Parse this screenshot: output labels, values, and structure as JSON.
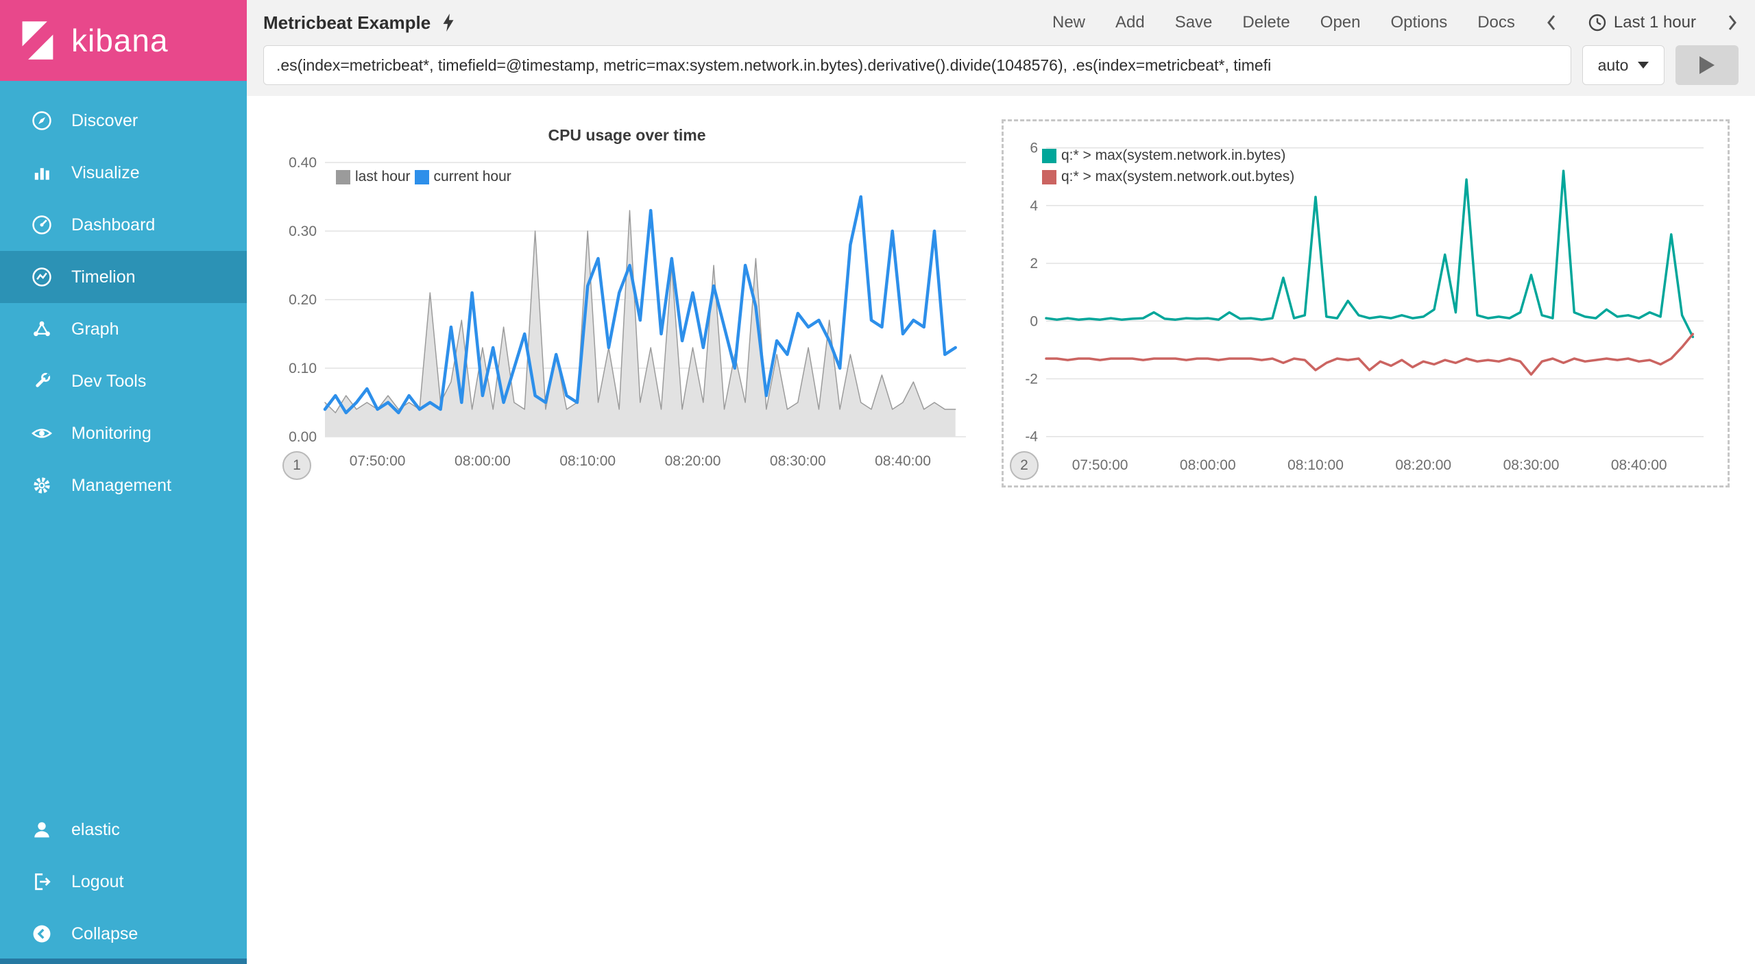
{
  "colors": {
    "brand_pink": "#e8488b",
    "sidebar_teal": "#3caed2",
    "sidebar_selected": "#2c92b5",
    "cpu_last_hour": "#9b9b9b",
    "cpu_current_hour": "#2d8fea",
    "network_in": "#00a69a",
    "network_out": "#cb6461"
  },
  "sidebar": {
    "logo_text": "kibana",
    "items": [
      {
        "label": "Discover",
        "icon": "discover-icon",
        "selected": false
      },
      {
        "label": "Visualize",
        "icon": "visualize-icon",
        "selected": false
      },
      {
        "label": "Dashboard",
        "icon": "dashboard-icon",
        "selected": false
      },
      {
        "label": "Timelion",
        "icon": "timelion-icon",
        "selected": true
      },
      {
        "label": "Graph",
        "icon": "graph-icon",
        "selected": false
      },
      {
        "label": "Dev Tools",
        "icon": "devtools-icon",
        "selected": false
      },
      {
        "label": "Monitoring",
        "icon": "monitoring-icon",
        "selected": false
      },
      {
        "label": "Management",
        "icon": "management-icon",
        "selected": false
      }
    ],
    "bottom_items": [
      {
        "label": "elastic",
        "icon": "user-icon"
      },
      {
        "label": "Logout",
        "icon": "logout-icon"
      },
      {
        "label": "Collapse",
        "icon": "collapse-icon"
      }
    ]
  },
  "topbar": {
    "title": "Metricbeat Example",
    "menu": [
      "New",
      "Add",
      "Save",
      "Delete",
      "Open",
      "Options",
      "Docs"
    ],
    "time_picker": "Last 1 hour"
  },
  "querybar": {
    "value": ".es(index=metricbeat*, timefield=@timestamp, metric=max:system.network.in.bytes).derivative().divide(1048576), .es(index=metricbeat*, timefi",
    "interval": "auto"
  },
  "chart_data": [
    {
      "type": "line",
      "title": "CPU usage over time",
      "panel_number": "1",
      "x_ticks": [
        "07:50:00",
        "08:00:00",
        "08:10:00",
        "08:20:00",
        "08:30:00",
        "08:40:00"
      ],
      "x_tick_pos": [
        5,
        15,
        25,
        35,
        45,
        55
      ],
      "x_range": [
        0,
        61
      ],
      "y_ticks": [
        0,
        0.1,
        0.2,
        0.3,
        0.4
      ],
      "y_tick_labels": [
        "0.00",
        "0.10",
        "0.20",
        "0.30",
        "0.40"
      ],
      "ylim": [
        0,
        0.405
      ],
      "legend_position": "top-left",
      "grid": true,
      "series": [
        {
          "name": "last hour",
          "color": "#9b9b9b",
          "fill": "#e2e2e2",
          "area": true,
          "stroke_width": 1.5,
          "values": [
            0.05,
            0.035,
            0.06,
            0.04,
            0.05,
            0.04,
            0.06,
            0.04,
            0.05,
            0.04,
            0.21,
            0.05,
            0.08,
            0.17,
            0.04,
            0.13,
            0.04,
            0.16,
            0.05,
            0.04,
            0.3,
            0.04,
            0.12,
            0.04,
            0.05,
            0.3,
            0.05,
            0.13,
            0.04,
            0.33,
            0.05,
            0.13,
            0.04,
            0.25,
            0.04,
            0.13,
            0.05,
            0.25,
            0.04,
            0.12,
            0.05,
            0.26,
            0.04,
            0.12,
            0.04,
            0.05,
            0.13,
            0.04,
            0.17,
            0.04,
            0.12,
            0.05,
            0.04,
            0.09,
            0.04,
            0.05,
            0.08,
            0.04,
            0.05,
            0.04,
            0.04
          ]
        },
        {
          "name": "current hour",
          "color": "#2d8fea",
          "area": false,
          "stroke_width": 4.5,
          "values": [
            0.04,
            0.06,
            0.035,
            0.05,
            0.07,
            0.04,
            0.05,
            0.035,
            0.06,
            0.04,
            0.05,
            0.04,
            0.16,
            0.05,
            0.21,
            0.06,
            0.13,
            0.05,
            0.1,
            0.15,
            0.06,
            0.05,
            0.12,
            0.06,
            0.05,
            0.22,
            0.26,
            0.13,
            0.21,
            0.25,
            0.17,
            0.33,
            0.15,
            0.26,
            0.14,
            0.21,
            0.13,
            0.22,
            0.16,
            0.1,
            0.25,
            0.19,
            0.06,
            0.14,
            0.12,
            0.18,
            0.16,
            0.17,
            0.14,
            0.1,
            0.28,
            0.35,
            0.17,
            0.16,
            0.3,
            0.15,
            0.17,
            0.16,
            0.3,
            0.12,
            0.13
          ]
        }
      ]
    },
    {
      "type": "line",
      "title": "",
      "panel_number": "2",
      "selected": true,
      "x_ticks": [
        "07:50:00",
        "08:00:00",
        "08:10:00",
        "08:20:00",
        "08:30:00",
        "08:40:00"
      ],
      "x_tick_pos": [
        5,
        15,
        25,
        35,
        45,
        55
      ],
      "x_range": [
        0,
        61
      ],
      "y_ticks": [
        6,
        4,
        2,
        0,
        -2,
        -4
      ],
      "y_tick_labels": [
        "6",
        "4",
        "2",
        "0",
        "-2",
        "-4"
      ],
      "ylim": [
        -4.15,
        6.3
      ],
      "legend_position": "top-left",
      "grid": true,
      "series": [
        {
          "name": "q:* > max(system.network.in.bytes)",
          "color": "#00a69a",
          "area": false,
          "stroke_width": 3.5,
          "values": [
            0.1,
            0.05,
            0.1,
            0.05,
            0.08,
            0.05,
            0.1,
            0.05,
            0.08,
            0.1,
            0.3,
            0.08,
            0.05,
            0.1,
            0.08,
            0.1,
            0.05,
            0.3,
            0.08,
            0.1,
            0.05,
            0.1,
            1.5,
            0.1,
            0.2,
            4.3,
            0.15,
            0.1,
            0.7,
            0.2,
            0.1,
            0.15,
            0.1,
            0.2,
            0.1,
            0.15,
            0.4,
            2.3,
            0.3,
            4.9,
            0.2,
            0.1,
            0.15,
            0.1,
            0.3,
            1.6,
            0.2,
            0.1,
            5.2,
            0.3,
            0.15,
            0.1,
            0.4,
            0.15,
            0.2,
            0.1,
            0.3,
            0.15,
            3.0,
            0.2,
            -0.55
          ]
        },
        {
          "name": "q:* > max(system.network.out.bytes)",
          "color": "#cb6461",
          "area": false,
          "stroke_width": 3.5,
          "values": [
            -1.3,
            -1.3,
            -1.35,
            -1.3,
            -1.3,
            -1.35,
            -1.3,
            -1.3,
            -1.3,
            -1.35,
            -1.3,
            -1.3,
            -1.3,
            -1.35,
            -1.3,
            -1.3,
            -1.35,
            -1.3,
            -1.3,
            -1.3,
            -1.35,
            -1.3,
            -1.45,
            -1.3,
            -1.35,
            -1.7,
            -1.45,
            -1.3,
            -1.35,
            -1.3,
            -1.7,
            -1.4,
            -1.55,
            -1.35,
            -1.6,
            -1.4,
            -1.5,
            -1.35,
            -1.45,
            -1.3,
            -1.4,
            -1.35,
            -1.4,
            -1.3,
            -1.4,
            -1.85,
            -1.4,
            -1.3,
            -1.45,
            -1.3,
            -1.4,
            -1.35,
            -1.3,
            -1.35,
            -1.3,
            -1.4,
            -1.35,
            -1.5,
            -1.3,
            -0.9,
            -0.45
          ]
        }
      ]
    }
  ]
}
